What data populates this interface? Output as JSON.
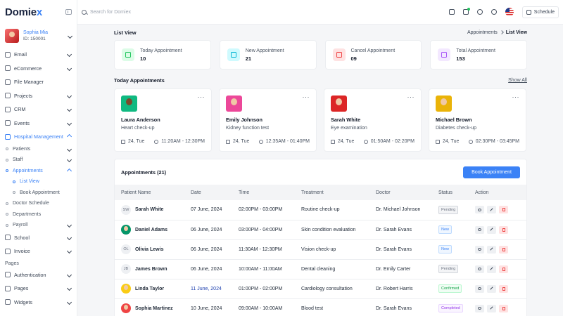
{
  "app": {
    "logo_text": "Domie",
    "logo_accent": "x"
  },
  "user": {
    "name": "Sophia Mia",
    "id": "ID: 150001"
  },
  "sidebar": {
    "items": [
      {
        "label": "Email",
        "icon": "mail-icon",
        "chevron": true
      },
      {
        "label": "eCommerce",
        "icon": "cart-icon",
        "chevron": true
      },
      {
        "label": "File Manager",
        "icon": "folder-icon",
        "chevron": false
      },
      {
        "label": "Projects",
        "icon": "monitor-icon",
        "chevron": true
      },
      {
        "label": "CRM",
        "icon": "crm-icon",
        "chevron": true
      },
      {
        "label": "Events",
        "icon": "trophy-icon",
        "chevron": true
      }
    ],
    "hospital": {
      "label": "Hospital Management",
      "subs": [
        {
          "label": "Patients"
        },
        {
          "label": "Staff"
        }
      ],
      "appointments": {
        "label": "Appointments",
        "children": [
          {
            "label": "List View"
          },
          {
            "label": "Book Appointment"
          }
        ]
      },
      "subs2": [
        {
          "label": "Doctor Schedule"
        },
        {
          "label": "Departments"
        },
        {
          "label": "Payroll"
        }
      ]
    },
    "items2": [
      {
        "label": "School"
      },
      {
        "label": "Invoice"
      }
    ],
    "section_pages": "Pages",
    "items3": [
      {
        "label": "Authentication"
      },
      {
        "label": "Pages"
      },
      {
        "label": "Widgets"
      }
    ]
  },
  "topbar": {
    "search_placeholder": "Search for Domiex",
    "schedule_label": "Schedule"
  },
  "page": {
    "title": "List View",
    "breadcrumb_parent": "Appointments",
    "breadcrumb_current": "List View"
  },
  "stats": [
    {
      "label": "Today Appointment",
      "value": "10",
      "color": "#22c55e",
      "bg": "#dcfce7"
    },
    {
      "label": "New Appointment",
      "value": "21",
      "color": "#06b6d4",
      "bg": "#cffafe"
    },
    {
      "label": "Cancel Appointment",
      "value": "09",
      "color": "#ef4444",
      "bg": "#fee2e2"
    },
    {
      "label": "Total Appointment",
      "value": "153",
      "color": "#a855f7",
      "bg": "#f3e8ff"
    }
  ],
  "today": {
    "title": "Today Appointments",
    "show_all": "Show All",
    "cards": [
      {
        "name": "Laura Anderson",
        "reason": "Heart check-up",
        "date": "24, Tue",
        "time": "11:20AM - 12:30PM",
        "color": "#10b981"
      },
      {
        "name": "Emily Johnson",
        "reason": "Kidney function test",
        "date": "24, Tue",
        "time": "12:35AM - 01:40PM",
        "color": "#ec4899"
      },
      {
        "name": "Sarah White",
        "reason": "Eye examination",
        "date": "24, Tue",
        "time": "01:50AM - 02:20PM",
        "color": "#dc2626"
      },
      {
        "name": "Michael Brown",
        "reason": "Diabetes check-up",
        "date": "24, Tue",
        "time": "02:30PM - 03:45PM",
        "color": "#eab308"
      }
    ]
  },
  "appointments": {
    "title": "Appointments (21)",
    "book_label": "Book Appointment",
    "columns": [
      "Patient Name",
      "Date",
      "Time",
      "Treatment",
      "Doctor",
      "Status",
      "Action"
    ],
    "rows": [
      {
        "initials": "SW",
        "name": "Sarah White",
        "date": "07 June, 2024",
        "time": "02:00PM - 03:00PM",
        "treatment": "Routine check-up",
        "doctor": "Dr. Michael Johnson",
        "status": "Pending"
      },
      {
        "initials": "",
        "name": "Daniel Adams",
        "date": "06 June, 2024",
        "time": "03:00PM - 04:00PM",
        "treatment": "Skin condition evaluation",
        "doctor": "Dr. Sarah Evans",
        "status": "New"
      },
      {
        "initials": "OL",
        "name": "Olivia Lewis",
        "date": "06 June, 2024",
        "time": "11:30AM - 12:30PM",
        "treatment": "Vision check-up",
        "doctor": "Dr. Sarah Evans",
        "status": "New"
      },
      {
        "initials": "JB",
        "name": "James Brown",
        "date": "06 June, 2024",
        "time": "10:00AM - 11:00AM",
        "treatment": "Dental cleaning",
        "doctor": "Dr. Emily Carter",
        "status": "Pending"
      },
      {
        "initials": "",
        "name": "Linda Taylor",
        "date": "11 June, 2024",
        "time": "01:00PM - 02:00PM",
        "treatment": "Cardiology consultation",
        "doctor": "Dr. Robert Harris",
        "status": "Confirmed"
      },
      {
        "initials": "",
        "name": "Sophia Martinez",
        "date": "10 June, 2024",
        "time": "09:00AM - 10:00AM",
        "treatment": "Blood test",
        "doctor": "Dr. Sarah Evans",
        "status": "Completed"
      }
    ]
  }
}
